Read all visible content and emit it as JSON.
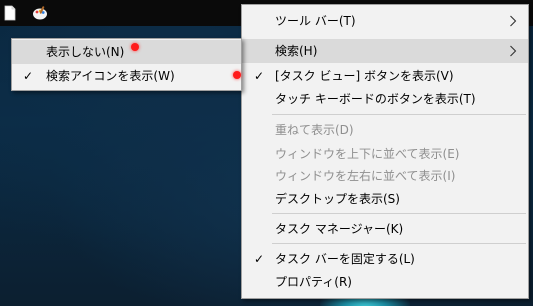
{
  "main_menu": {
    "items": [
      {
        "label": "ツール バー(T)"
      },
      {
        "label": "検索(H)"
      },
      {
        "label": "[タスク ビュー] ボタンを表示(V)"
      },
      {
        "label": "タッチ キーボードのボタンを表示(T)"
      },
      {
        "label": "重ねて表示(D)"
      },
      {
        "label": "ウィンドウを上下に並べて表示(E)"
      },
      {
        "label": "ウィンドウを左右に並べて表示(I)"
      },
      {
        "label": "デスクトップを表示(S)"
      },
      {
        "label": "タスク マネージャー(K)"
      },
      {
        "label": "タスク バーを固定する(L)"
      },
      {
        "label": "プロパティ(R)"
      }
    ],
    "checked": [
      "[タスク ビュー] ボタンを表示(V)",
      "タスク バーを固定する(L)"
    ],
    "disabled": [
      "重ねて表示(D)",
      "ウィンドウを上下に並べて表示(E)",
      "ウィンドウを左右に並べて表示(I)"
    ],
    "highlighted": "検索(H)"
  },
  "search_submenu": {
    "items": [
      {
        "label": "表示しない(N)"
      },
      {
        "label": "検索アイコンを表示(W)"
      }
    ],
    "checked": "検索アイコンを表示(W)",
    "highlighted": "表示しない(N)"
  },
  "icons": {
    "check": "✓",
    "submenu_arrow": "chevron-right-icon",
    "taskbar": [
      "file-icon",
      "paint-icon"
    ]
  },
  "colors": {
    "menu_bg": "#f2f2f2",
    "highlight": "#dadada",
    "disabled_text": "#8f8f8f",
    "taskbar": "#0a0a0a",
    "marker_dot": "#ff1a1a"
  }
}
